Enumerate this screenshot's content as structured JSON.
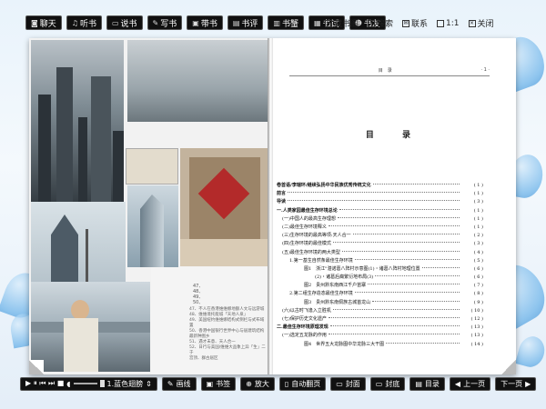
{
  "toolbar_top": {
    "buttons": [
      {
        "icon": "chat-icon",
        "label": "聊天"
      },
      {
        "icon": "headphones-icon",
        "label": "听书"
      },
      {
        "icon": "speech-icon",
        "label": "说书"
      },
      {
        "icon": "pen-icon",
        "label": "写书"
      },
      {
        "icon": "book-icon",
        "label": "带书"
      },
      {
        "icon": "review-icon",
        "label": "书评"
      },
      {
        "icon": "crab-icon",
        "label": "书蟹"
      },
      {
        "icon": "test-icon",
        "label": "书试"
      },
      {
        "icon": "friends-icon",
        "label": "书友"
      }
    ],
    "right": [
      {
        "icon": "bookshelf-icon",
        "label": "藏书阁"
      },
      {
        "icon": "search-icon",
        "label": "搜索"
      },
      {
        "icon": "contact-icon",
        "label": "联系"
      },
      {
        "icon": "zoom-ratio-icon",
        "label": "1:1"
      },
      {
        "icon": "close-icon",
        "label": "关闭"
      }
    ]
  },
  "left_page": {
    "figure_label": "47、\n48、\n49、\n50、",
    "captions": "47、不人在香港维维娜地额人文与远游城\n48、维维境托能城「天地人泉」\n49、美国纽约维维娜结构式侧栏与式布域置\n50、香港中国银行世界中心与居建筑结构最新种图乡\n51、遇才未意、天人合一\n52、日行与美国/维维大品象上异「生」二于\n宫顶、群古居区"
  },
  "right_page": {
    "header_left": "",
    "header_center": "目　录",
    "header_right": "· 1 ·",
    "toc_title": "目 录",
    "toc": [
      {
        "text": "卷首语/李瑞环/继续弘扬中华民族优秀传统文化",
        "page": "( 1 )",
        "level": 0,
        "bold": true
      },
      {
        "text": "前言",
        "page": "( 1 )",
        "level": 0,
        "bold": true
      },
      {
        "text": "导读",
        "page": "( 3 )",
        "level": 0,
        "bold": true
      },
      {
        "text": "一.人类家园最佳生存环境总论",
        "page": "( 1 )",
        "level": 0,
        "bold": true
      },
      {
        "text": "(一)中国人的最高生存理想",
        "page": "( 1 )",
        "level": 1,
        "bold": false
      },
      {
        "text": "(二)最佳生存环境释义",
        "page": "( 1 )",
        "level": 1,
        "bold": false
      },
      {
        "text": "(三)生存环境的最高等项:天人合一",
        "page": "( 2 )",
        "level": 1,
        "bold": false
      },
      {
        "text": "(四)生存环境的最佳模式",
        "page": "( 3 )",
        "level": 1,
        "bold": false
      },
      {
        "text": "(五)最佳生存环境的两大类型",
        "page": "( 4 )",
        "level": 1,
        "bold": false
      },
      {
        "text": "1.第一基生自然条最佳生存环境",
        "page": "( 5 )",
        "level": 2,
        "bold": false
      },
      {
        "text": "图1　浙江\"湛诺葛八阵村示意图(1)・诸葛八阵村地理位置",
        "page": "( 6 )",
        "level": 3,
        "bold": false
      },
      {
        "text": "(2)・诸葛后裔繁衍地布局(3)",
        "page": "( 6 )",
        "level": 4,
        "bold": false
      },
      {
        "text": "图2　贵州黔东南西江千户苗寨",
        "page": "( 7 )",
        "level": 3,
        "bold": false
      },
      {
        "text": "2.第二组生存造态最佳生存环境",
        "page": "( 8 )",
        "level": 2,
        "bold": false
      },
      {
        "text": "图3　贵州黔东南侗族古城首龙山",
        "page": "( 9 )",
        "level": 3,
        "bold": false
      },
      {
        "text": "(六)以古时飞逢入立胜机",
        "page": "( 10 )",
        "level": 1,
        "bold": false
      },
      {
        "text": "(七)保护历史文化遗产",
        "page": "( 12 )",
        "level": 1,
        "bold": false
      },
      {
        "text": "二.最佳生存环境原理发现",
        "page": "( 13 )",
        "level": 0,
        "bold": true
      },
      {
        "text": "(一)选定五龙脉的作用",
        "page": "( 13 )",
        "level": 1,
        "bold": false
      },
      {
        "text": "图4　世界五大龙脉图中华龙脉三大干图",
        "page": "( 14 )",
        "level": 3,
        "bold": false
      }
    ]
  },
  "toolbar_bottom": {
    "media_controls": "▶ ⏸ ⏮ ⏭ ■",
    "volume_icon": "speaker-icon",
    "track_label": "1.蓝色翅膀",
    "buttons": [
      {
        "icon": "brush-icon",
        "label": "画线"
      },
      {
        "icon": "bookmark-icon",
        "label": "书签"
      },
      {
        "icon": "zoom-icon",
        "label": "放大"
      },
      {
        "icon": "autoflip-icon",
        "label": "自动翻页"
      },
      {
        "icon": "cover-icon",
        "label": "封面"
      },
      {
        "icon": "back-cover-icon",
        "label": "封底"
      },
      {
        "icon": "contents-icon",
        "label": "目录"
      },
      {
        "icon": "prev-icon",
        "label": "上一页"
      },
      {
        "icon": "next-icon",
        "label": "下一页"
      }
    ]
  },
  "colors": {
    "toolbar_bg": "#111111",
    "toolbar_text": "#ffffff",
    "background": "#e9f3fb",
    "accent_blue": "#6fb5ea"
  }
}
